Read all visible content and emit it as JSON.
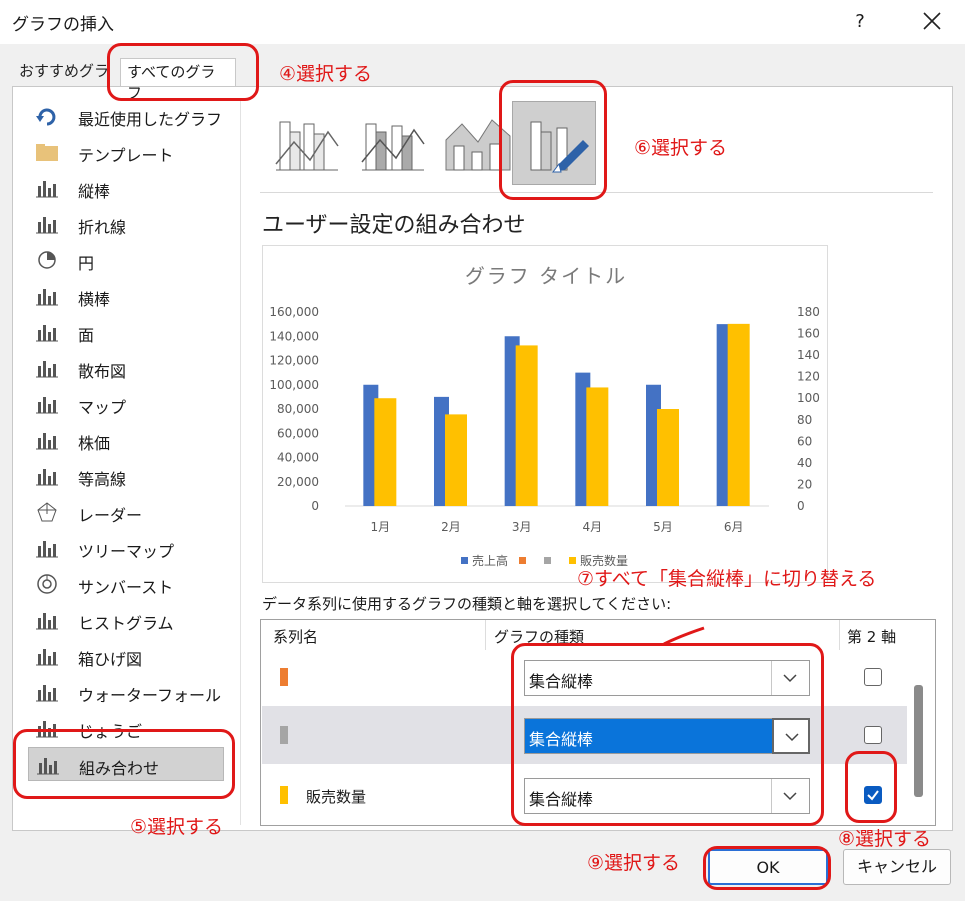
{
  "window": {
    "title": "グラフの挿入",
    "help": "?"
  },
  "tabs": [
    {
      "label": "おすすめグラフ"
    },
    {
      "label": "すべてのグラフ"
    }
  ],
  "categories": [
    {
      "label": "最近使用したグラフ",
      "icon": "recent-icon"
    },
    {
      "label": "テンプレート",
      "icon": "folder-icon"
    },
    {
      "label": "縦棒",
      "icon": "column-chart-icon"
    },
    {
      "label": "折れ線",
      "icon": "line-chart-icon"
    },
    {
      "label": "円",
      "icon": "pie-chart-icon"
    },
    {
      "label": "横棒",
      "icon": "bar-chart-icon"
    },
    {
      "label": "面",
      "icon": "area-chart-icon"
    },
    {
      "label": "散布図",
      "icon": "scatter-chart-icon"
    },
    {
      "label": "マップ",
      "icon": "map-chart-icon"
    },
    {
      "label": "株価",
      "icon": "stock-chart-icon"
    },
    {
      "label": "等高線",
      "icon": "surface-chart-icon"
    },
    {
      "label": "レーダー",
      "icon": "radar-chart-icon"
    },
    {
      "label": "ツリーマップ",
      "icon": "treemap-chart-icon"
    },
    {
      "label": "サンバースト",
      "icon": "sunburst-chart-icon"
    },
    {
      "label": "ヒストグラム",
      "icon": "histogram-chart-icon"
    },
    {
      "label": "箱ひげ図",
      "icon": "boxwhisker-chart-icon"
    },
    {
      "label": "ウォーターフォール",
      "icon": "waterfall-chart-icon"
    },
    {
      "label": "じょうご",
      "icon": "funnel-chart-icon"
    },
    {
      "label": "組み合わせ",
      "icon": "combo-chart-icon",
      "selected": true
    }
  ],
  "subtype_heading": "ユーザー設定の組み合わせ",
  "chart_data": {
    "type": "bar",
    "title": "グラフ タイトル",
    "categories": [
      "1月",
      "2月",
      "3月",
      "4月",
      "5月",
      "6月"
    ],
    "series": [
      {
        "name": "売上高",
        "color": "#4472c4",
        "axis": "primary",
        "values": [
          100000,
          90000,
          140000,
          110000,
          100000,
          150000
        ]
      },
      {
        "name": "",
        "color": "#ed7d31",
        "axis": "primary",
        "values": []
      },
      {
        "name": "",
        "color": "#a5a5a5",
        "axis": "primary",
        "values": []
      },
      {
        "name": "販売数量",
        "color": "#ffc000",
        "axis": "secondary",
        "values": [
          100,
          85,
          149,
          110,
          90,
          169
        ]
      }
    ],
    "ylim": [
      0,
      160000
    ],
    "y_ticks": [
      "160,000",
      "140,000",
      "120,000",
      "100,000",
      "80,000",
      "60,000",
      "40,000",
      "20,000",
      "0"
    ],
    "y2lim": [
      0,
      180
    ],
    "y2_ticks": [
      "180",
      "160",
      "140",
      "120",
      "100",
      "80",
      "60",
      "40",
      "20",
      "0"
    ],
    "legend": "bottom",
    "grid": false
  },
  "series_table": {
    "instruction": "データ系列に使用するグラフの種類と軸を選択してください:",
    "col_name": "系列名",
    "col_type": "グラフの種類",
    "col_axis": "第 2 軸",
    "rows": [
      {
        "name": "",
        "color": "#ed7d31",
        "type": "集合縦棒",
        "secondary": false
      },
      {
        "name": "",
        "color": "#a5a5a5",
        "type": "集合縦棒",
        "secondary": false,
        "active": true
      },
      {
        "name": "販売数量",
        "color": "#ffc000",
        "type": "集合縦棒",
        "secondary": true
      }
    ]
  },
  "buttons": {
    "ok": "OK",
    "cancel": "キャンセル"
  },
  "annotations": {
    "a4": "④選択する",
    "a5": "⑤選択する",
    "a6": "⑥選択する",
    "a7": "⑦すべて「集合縦棒」に切り替える",
    "a8": "⑧選択する",
    "a9": "⑨選択する",
    "color": "#e01818"
  }
}
